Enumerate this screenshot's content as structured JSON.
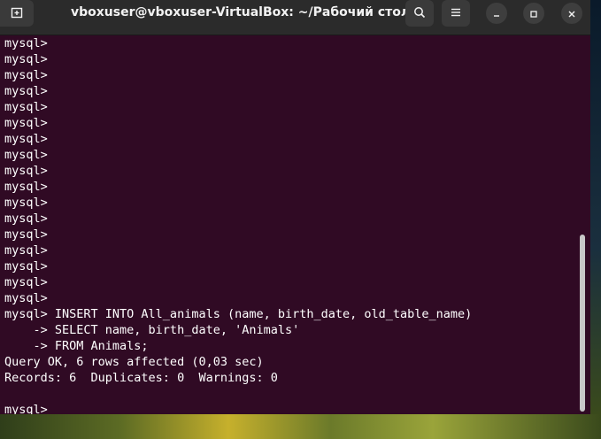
{
  "window": {
    "title": "vboxuser@vboxuser-VirtualBox: ~/Рабочий стол"
  },
  "icons": {
    "new_tab": "new-tab-icon",
    "search": "search-icon",
    "menu": "hamburger-menu-icon",
    "minimize": "minimize-icon",
    "maximize": "maximize-icon",
    "close": "close-icon"
  },
  "colors": {
    "terminal_bg": "#300a24",
    "titlebar_bg": "#2b2b2b",
    "text": "#ffffff"
  },
  "terminal": {
    "lines": [
      "mysql>",
      "mysql>",
      "mysql>",
      "mysql>",
      "mysql>",
      "mysql>",
      "mysql>",
      "mysql>",
      "mysql>",
      "mysql>",
      "mysql>",
      "mysql>",
      "mysql>",
      "mysql>",
      "mysql>",
      "mysql>",
      "mysql>",
      "mysql> INSERT INTO All_animals (name, birth_date, old_table_name)",
      "    -> SELECT name, birth_date, 'Animals'",
      "    -> FROM Animals;",
      "Query OK, 6 rows affected (0,03 sec)",
      "Records: 6  Duplicates: 0  Warnings: 0",
      "",
      "mysql>"
    ]
  }
}
